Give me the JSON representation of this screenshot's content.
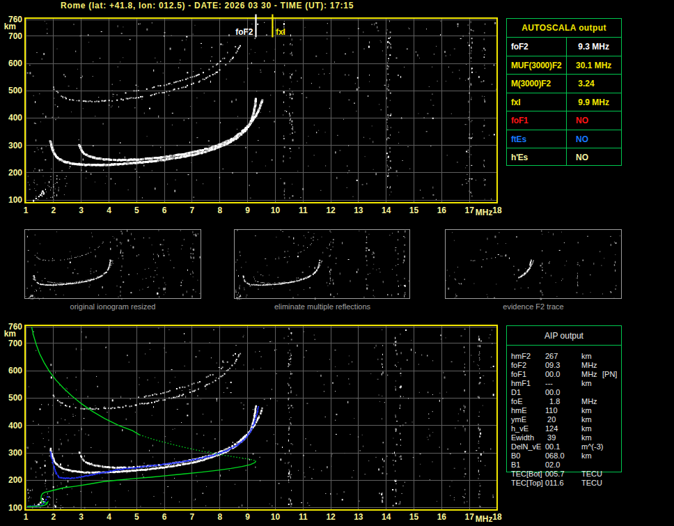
{
  "window": {
    "title": "Rome (lat: +41.8, lon: 012.5) - DATE: 2026 03 30 - TIME (UT): 17:15",
    "title_color": "#f6ee6f",
    "background": "#000000"
  },
  "autoscala": {
    "header": "AUTOSCALA output",
    "header_color": "#f3e800",
    "border_color": "#00c850",
    "rows": [
      {
        "param": "foF2",
        "value": " 9.3 MHz",
        "color": "#ffffff"
      },
      {
        "param": "MUF(3000)F2",
        "value": "30.1 MHz",
        "color": "#f3e800"
      },
      {
        "param": "M(3000)F2",
        "value": " 3.24",
        "color": "#f3e800"
      },
      {
        "param": "fxI",
        "value": " 9.9 MHz",
        "color": "#f3e800"
      },
      {
        "param": "foF1",
        "value": "NO",
        "color": "#ff1515"
      },
      {
        "param": "ftEs",
        "value": "NO",
        "color": "#1779ff"
      },
      {
        "param": "h'Es",
        "value": "NO",
        "color": "#f5f3a0"
      }
    ]
  },
  "aip": {
    "header": "AIP output",
    "text_color": "#eaeaea",
    "border_color": "#00c850",
    "rows": [
      {
        "param": "hmF2",
        "value": "267",
        "unit": "km",
        "note": ""
      },
      {
        "param": "foF2",
        "value": "09.3",
        "unit": "MHz",
        "note": ""
      },
      {
        "param": "foF1",
        "value": "00.0",
        "unit": "MHz",
        "note": "[PN]"
      },
      {
        "param": "hmF1",
        "value": "---",
        "unit": "km",
        "note": ""
      },
      {
        "param": "D1",
        "value": "00.0",
        "unit": "",
        "note": ""
      },
      {
        "param": "foE",
        "value": "  1.8",
        "unit": "MHz",
        "note": ""
      },
      {
        "param": "hmE",
        "value": "110",
        "unit": "km",
        "note": ""
      },
      {
        "param": "ymE",
        "value": " 20",
        "unit": "km",
        "note": ""
      },
      {
        "param": "h_vE",
        "value": "124",
        "unit": "km",
        "note": ""
      },
      {
        "param": "Ewidth",
        "value": " 39",
        "unit": "km",
        "note": ""
      },
      {
        "param": "DelN_vE",
        "value": "00.1",
        "unit": "m^(-3)",
        "note": ""
      },
      {
        "param": "B0",
        "value": "068.0",
        "unit": "km",
        "note": ""
      },
      {
        "param": "B1",
        "value": "02.0",
        "unit": "",
        "note": ""
      },
      {
        "param": "TEC[Bot]",
        "value": "005.7",
        "unit": "TECU",
        "note": ""
      },
      {
        "param": "TEC[Top]",
        "value": "011.6",
        "unit": "TECU",
        "note": ""
      }
    ]
  },
  "thumbnails": [
    {
      "caption": "original ionogram resized"
    },
    {
      "caption": "eliminate multiple reflections"
    },
    {
      "caption": "evidence F2 trace"
    }
  ],
  "chart_data": {
    "type": "scatter",
    "x_unit": "MHz",
    "y_unit": "km",
    "xlim": [
      1,
      18
    ],
    "ylim": [
      100,
      760
    ],
    "xticks": [
      1,
      2,
      3,
      4,
      5,
      6,
      7,
      8,
      9,
      10,
      11,
      12,
      13,
      14,
      15,
      16,
      17,
      18
    ],
    "yticks": [
      760,
      700,
      600,
      500,
      400,
      300,
      200,
      100
    ],
    "grid": true,
    "markers": [
      {
        "label": "foF2",
        "x": 9.3,
        "color": "#ffffff"
      },
      {
        "label": "fxI",
        "x": 9.9,
        "color": "#f3e800"
      }
    ],
    "series": {
      "o_trace": [
        [
          1.89,
          315
        ],
        [
          1.96,
          288
        ],
        [
          2.05,
          266
        ],
        [
          2.2,
          250
        ],
        [
          2.4,
          240
        ],
        [
          2.7,
          233
        ],
        [
          3.1,
          229
        ],
        [
          3.5,
          228
        ],
        [
          4.0,
          229
        ],
        [
          4.5,
          232
        ],
        [
          5.0,
          236
        ],
        [
          5.5,
          241
        ],
        [
          6.0,
          247
        ],
        [
          6.5,
          255
        ],
        [
          7.0,
          264
        ],
        [
          7.4,
          274
        ],
        [
          7.8,
          287
        ],
        [
          8.2,
          303
        ],
        [
          8.6,
          326
        ],
        [
          8.9,
          352
        ],
        [
          9.1,
          380
        ],
        [
          9.2,
          410
        ],
        [
          9.27,
          445
        ],
        [
          9.3,
          475
        ]
      ],
      "x_trace": [
        [
          2.93,
          302
        ],
        [
          3.0,
          285
        ],
        [
          3.1,
          270
        ],
        [
          3.25,
          262
        ],
        [
          3.5,
          254
        ],
        [
          3.8,
          249
        ],
        [
          4.2,
          246
        ],
        [
          4.7,
          246
        ],
        [
          5.2,
          249
        ],
        [
          5.7,
          254
        ],
        [
          6.2,
          260
        ],
        [
          6.7,
          268
        ],
        [
          7.2,
          278
        ],
        [
          7.7,
          292
        ],
        [
          8.1,
          307
        ],
        [
          8.5,
          327
        ],
        [
          8.8,
          350
        ],
        [
          9.1,
          380
        ],
        [
          9.3,
          408
        ],
        [
          9.45,
          440
        ],
        [
          9.55,
          470
        ]
      ],
      "second_hop_o": [
        [
          2.0,
          512
        ],
        [
          2.15,
          492
        ],
        [
          2.35,
          477
        ],
        [
          2.6,
          468
        ],
        [
          3.0,
          462
        ],
        [
          3.5,
          461
        ],
        [
          4.0,
          463
        ],
        [
          4.5,
          468
        ],
        [
          5.0,
          475
        ],
        [
          5.5,
          484
        ],
        [
          6.0,
          494
        ],
        [
          6.5,
          507
        ],
        [
          7.0,
          523
        ],
        [
          7.4,
          540
        ],
        [
          7.8,
          562
        ],
        [
          8.1,
          584
        ],
        [
          8.4,
          612
        ],
        [
          8.6,
          640
        ],
        [
          8.75,
          668
        ]
      ],
      "second_hop_x": [
        [
          4.6,
          492
        ],
        [
          5.0,
          500
        ],
        [
          5.5,
          510
        ],
        [
          6.0,
          521
        ],
        [
          6.5,
          534
        ],
        [
          7.0,
          550
        ],
        [
          7.4,
          567
        ],
        [
          7.8,
          591
        ],
        [
          8.1,
          613
        ],
        [
          8.4,
          641
        ],
        [
          8.6,
          668
        ]
      ],
      "e_trace": [
        [
          1.5,
          121
        ],
        [
          1.55,
          126
        ],
        [
          1.6,
          132
        ],
        [
          1.52,
          120
        ],
        [
          1.62,
          124
        ],
        [
          1.45,
          115
        ],
        [
          1.35,
          108
        ],
        [
          1.58,
          135
        ]
      ],
      "fitted_trace_blue": [
        [
          1.89,
          302
        ],
        [
          1.95,
          275
        ],
        [
          2.02,
          248
        ],
        [
          2.1,
          225
        ],
        [
          2.2,
          211
        ],
        [
          2.35,
          207
        ],
        [
          2.55,
          207
        ],
        [
          2.8,
          209
        ],
        [
          3.1,
          214
        ],
        [
          3.5,
          222
        ],
        [
          3.9,
          230
        ],
        [
          4.3,
          238
        ],
        [
          4.8,
          244
        ],
        [
          5.3,
          250
        ],
        [
          5.8,
          256
        ],
        [
          6.3,
          262
        ],
        [
          6.8,
          270
        ],
        [
          7.3,
          280
        ],
        [
          7.8,
          292
        ],
        [
          8.2,
          306
        ],
        [
          8.6,
          326
        ],
        [
          8.9,
          350
        ],
        [
          9.1,
          378
        ],
        [
          9.25,
          410
        ],
        [
          9.35,
          445
        ],
        [
          9.4,
          472
        ]
      ],
      "fitted_e_blue": [
        [
          1.0,
          104
        ],
        [
          1.12,
          104
        ],
        [
          1.25,
          105
        ],
        [
          1.38,
          105
        ],
        [
          1.5,
          107
        ],
        [
          1.58,
          110
        ],
        [
          1.64,
          115
        ],
        [
          1.7,
          122
        ],
        [
          1.74,
          130
        ],
        [
          1.78,
          139
        ],
        [
          1.81,
          148
        ]
      ],
      "profile_green": {
        "topside_solid": [
          [
            1.21,
            760
          ],
          [
            1.28,
            728
          ],
          [
            1.38,
            695
          ],
          [
            1.5,
            662
          ],
          [
            1.66,
            630
          ],
          [
            1.85,
            598
          ],
          [
            2.08,
            567
          ],
          [
            2.35,
            537
          ],
          [
            2.66,
            508
          ],
          [
            3.0,
            480
          ],
          [
            3.4,
            452
          ],
          [
            3.85,
            425
          ],
          [
            4.35,
            400
          ],
          [
            4.85,
            381
          ],
          [
            5.1,
            366
          ]
        ],
        "topside_dotted": [
          [
            5.1,
            366
          ],
          [
            5.6,
            349
          ],
          [
            6.2,
            333
          ],
          [
            6.8,
            318
          ],
          [
            7.4,
            305
          ],
          [
            8.0,
            294
          ],
          [
            8.6,
            284
          ],
          [
            9.05,
            277
          ],
          [
            9.3,
            271
          ]
        ],
        "bottomside": [
          [
            9.3,
            271
          ],
          [
            9.27,
            265
          ],
          [
            9.1,
            257
          ],
          [
            8.8,
            250
          ],
          [
            8.4,
            243
          ],
          [
            7.9,
            236
          ],
          [
            7.3,
            229
          ],
          [
            6.7,
            223
          ],
          [
            6.1,
            217
          ],
          [
            5.5,
            211
          ],
          [
            4.9,
            206
          ],
          [
            4.3,
            200
          ],
          [
            3.8,
            195
          ],
          [
            3.3,
            186
          ],
          [
            2.8,
            178
          ],
          [
            2.35,
            172
          ],
          [
            2.0,
            163
          ],
          [
            1.8,
            158
          ],
          [
            1.68,
            156
          ],
          [
            1.6,
            151
          ],
          [
            1.56,
            143
          ],
          [
            1.55,
            134
          ],
          [
            1.56,
            126
          ],
          [
            1.61,
            120
          ],
          [
            1.68,
            117
          ],
          [
            1.75,
            117
          ],
          [
            1.79,
            120
          ],
          [
            1.76,
            113
          ],
          [
            1.68,
            109
          ],
          [
            1.56,
            106
          ],
          [
            1.42,
            105
          ],
          [
            1.25,
            104
          ],
          [
            1.05,
            104
          ]
        ]
      }
    },
    "noise": {
      "seed_top": 20260330,
      "seed_bottom": 17151717,
      "uniform_count": 430,
      "lowfreq_cluster_count": 58,
      "streak_bands": [
        [
          10.1,
          10.6
        ],
        [
          13.7,
          14.6
        ],
        [
          16.8,
          17.6
        ]
      ],
      "streak_count": 72
    },
    "colors": {
      "trace": "#ffffff",
      "trace_dim": "#b9b9b9",
      "noise_dim1": "#a6a6a6",
      "noise_dim2": "#787878",
      "blue": "#2230f5",
      "green": "#00d81e",
      "grid": "#5f5f5f",
      "frame": "#f3e800",
      "labels": "#f9f598",
      "thumb_border": "#9e9e9e"
    }
  }
}
